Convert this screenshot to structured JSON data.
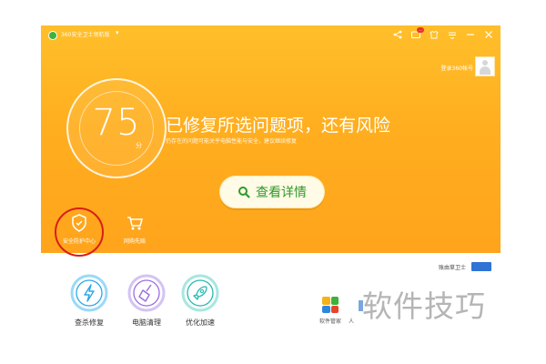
{
  "titlebar": {
    "title": "360安全卫士领航版",
    "caret": "▾"
  },
  "window_controls": {
    "share_icon": "share-icon",
    "message_icon": "message-icon",
    "message_badge": "...",
    "skin_icon": "skin-icon",
    "menu_icon": "menu-icon",
    "minimize_icon": "minimize-icon",
    "close_icon": "close-icon"
  },
  "account": {
    "login_label": "登录360帐号"
  },
  "status": {
    "score": "75",
    "score_unit": "分",
    "headline": "已修复所选问题项，还有风险",
    "subline": "仍存在的问题可能关乎电脑性能与安全，建议继续修复",
    "details_button": "查看详情"
  },
  "tools": [
    {
      "label": "安全防护中心",
      "icon": "shield-icon"
    },
    {
      "label": "网购先赔",
      "icon": "cart-icon"
    }
  ],
  "main_functions": [
    {
      "label": "查杀修复",
      "icon": "lightning-icon",
      "color": "#2aa7e8"
    },
    {
      "label": "电脑清理",
      "icon": "broom-icon",
      "color": "#9b6ee0"
    },
    {
      "label": "优化加速",
      "icon": "rocket-icon",
      "color": "#27b9b0"
    }
  ],
  "right_panel": {
    "button_text": "账由草卫士"
  },
  "apps": [
    {
      "label": "软件管家",
      "icon": "software-manager-icon"
    },
    {
      "label": "人",
      "icon": "app-icon"
    }
  ],
  "watermark": "软件技巧",
  "colors": {
    "panel": "#ffae1f",
    "accent_green": "#2f9a2c",
    "highlight_red": "#d91e17"
  }
}
